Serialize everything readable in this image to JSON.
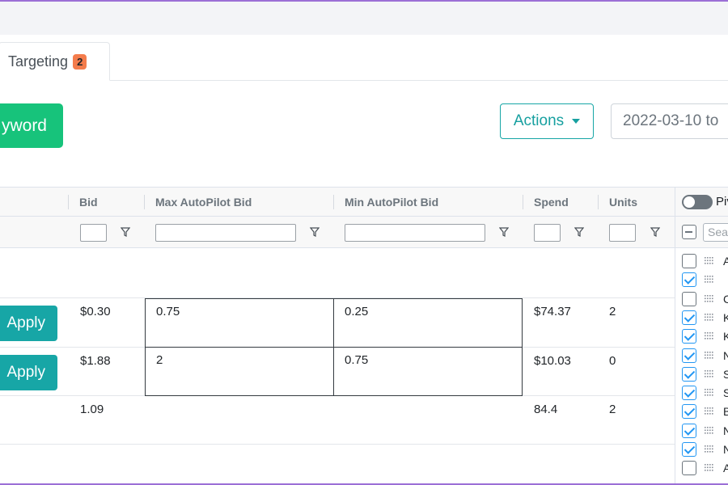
{
  "tabs": [
    {
      "label": "Targeting",
      "badge": "2"
    }
  ],
  "toolbar": {
    "add_label": "yword",
    "actions_label": "Actions",
    "date_value": "2022-03-10 to"
  },
  "grid": {
    "columns": [
      "Bid",
      "Max AutoPilot Bid",
      "Min AutoPilot Bid",
      "Spend",
      "Units"
    ],
    "rows": [
      {
        "action": "Apply",
        "bid": "$0.30",
        "max_bid": "0.75",
        "min_bid": "0.25",
        "spend": "$74.37",
        "units": "2"
      },
      {
        "action": "Apply",
        "bid": "$1.88",
        "max_bid": "2",
        "min_bid": "0.75",
        "spend": "$10.03",
        "units": "0"
      }
    ],
    "totals": {
      "bid": "1.09",
      "spend": "84.4",
      "units": "2"
    }
  },
  "sidebar": {
    "pivot_label": "Piv",
    "search_placeholder": "Sea",
    "items": [
      {
        "letter": "A",
        "checked": false
      },
      {
        "letter": "",
        "checked": true
      },
      {
        "letter": "C",
        "checked": false
      },
      {
        "letter": "K",
        "checked": true
      },
      {
        "letter": "K",
        "checked": true
      },
      {
        "letter": "N",
        "checked": true
      },
      {
        "letter": "S",
        "checked": true
      },
      {
        "letter": "S",
        "checked": true
      },
      {
        "letter": "B",
        "checked": true
      },
      {
        "letter": "N",
        "checked": true
      },
      {
        "letter": "N",
        "checked": true
      },
      {
        "letter": "A",
        "checked": false
      }
    ]
  },
  "colors": {
    "primary_green": "#17c37b",
    "teal": "#17a6a6",
    "badge_orange": "#f47c4c",
    "checkbox_blue": "#2196f3"
  }
}
